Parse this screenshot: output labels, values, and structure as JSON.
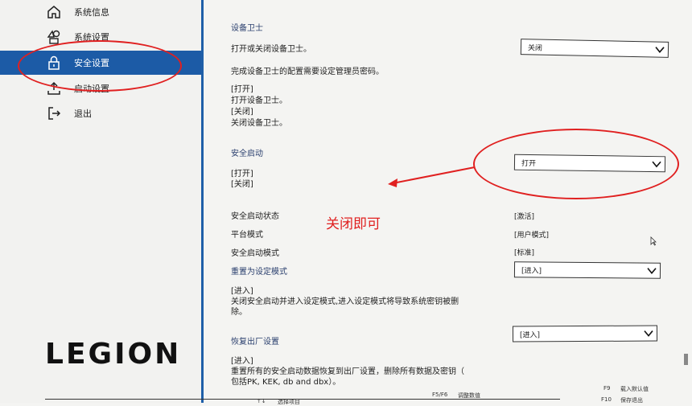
{
  "sidebar": {
    "items": [
      {
        "label": "系统信息",
        "icon": "home-icon"
      },
      {
        "label": "系统设置",
        "icon": "shapes-icon"
      },
      {
        "label": "安全设置",
        "icon": "lock-icon",
        "active": true
      },
      {
        "label": "启动设置",
        "icon": "boot-icon"
      },
      {
        "label": "退出",
        "icon": "exit-icon"
      }
    ],
    "logo": "LEGION"
  },
  "device_guard": {
    "title": "设备卫士",
    "description": "打开或关闭设备卫士。",
    "note": "完成设备卫士的配置需要设定管理员密码。",
    "help": [
      "[打开]",
      "打开设备卫士。",
      "[关闭]",
      "关闭设备卫士。"
    ],
    "value": "关闭"
  },
  "secure_boot": {
    "title": "安全启动",
    "options": [
      "[打开]",
      "[关闭]"
    ],
    "value": "打开",
    "annotation": "关闭即可"
  },
  "status": {
    "rows": [
      {
        "label": "安全启动状态",
        "value": "[激活]"
      },
      {
        "label": "平台模式",
        "value": "[用户模式]"
      },
      {
        "label": "安全启动模式",
        "value": "[标准]"
      }
    ]
  },
  "reset_setup": {
    "title": "重置为设定模式",
    "value": "[进入]",
    "help": [
      "[进入]",
      "关闭安全启动并进入设定模式,进入设定模式将导致系统密钥被删",
      "除。"
    ]
  },
  "factory_reset": {
    "title": "恢复出厂设置",
    "value": "[进入]",
    "help": [
      "[进入]",
      "重置所有的安全启动数据恢复到出厂设置，删除所有数据及密钥（",
      "包括PK, KEK, db and dbx）。"
    ]
  },
  "footer": {
    "left_key": "↑↓",
    "left_text": "选择项目",
    "mid_key": "F5/F6",
    "mid_text": "调整数值",
    "right_key1": "F9",
    "right_text1": "载入默认值",
    "right_key2": "F10",
    "right_text2": "保存退出"
  },
  "colors": {
    "accent": "#1c5ba6",
    "annotation": "#e02020"
  }
}
